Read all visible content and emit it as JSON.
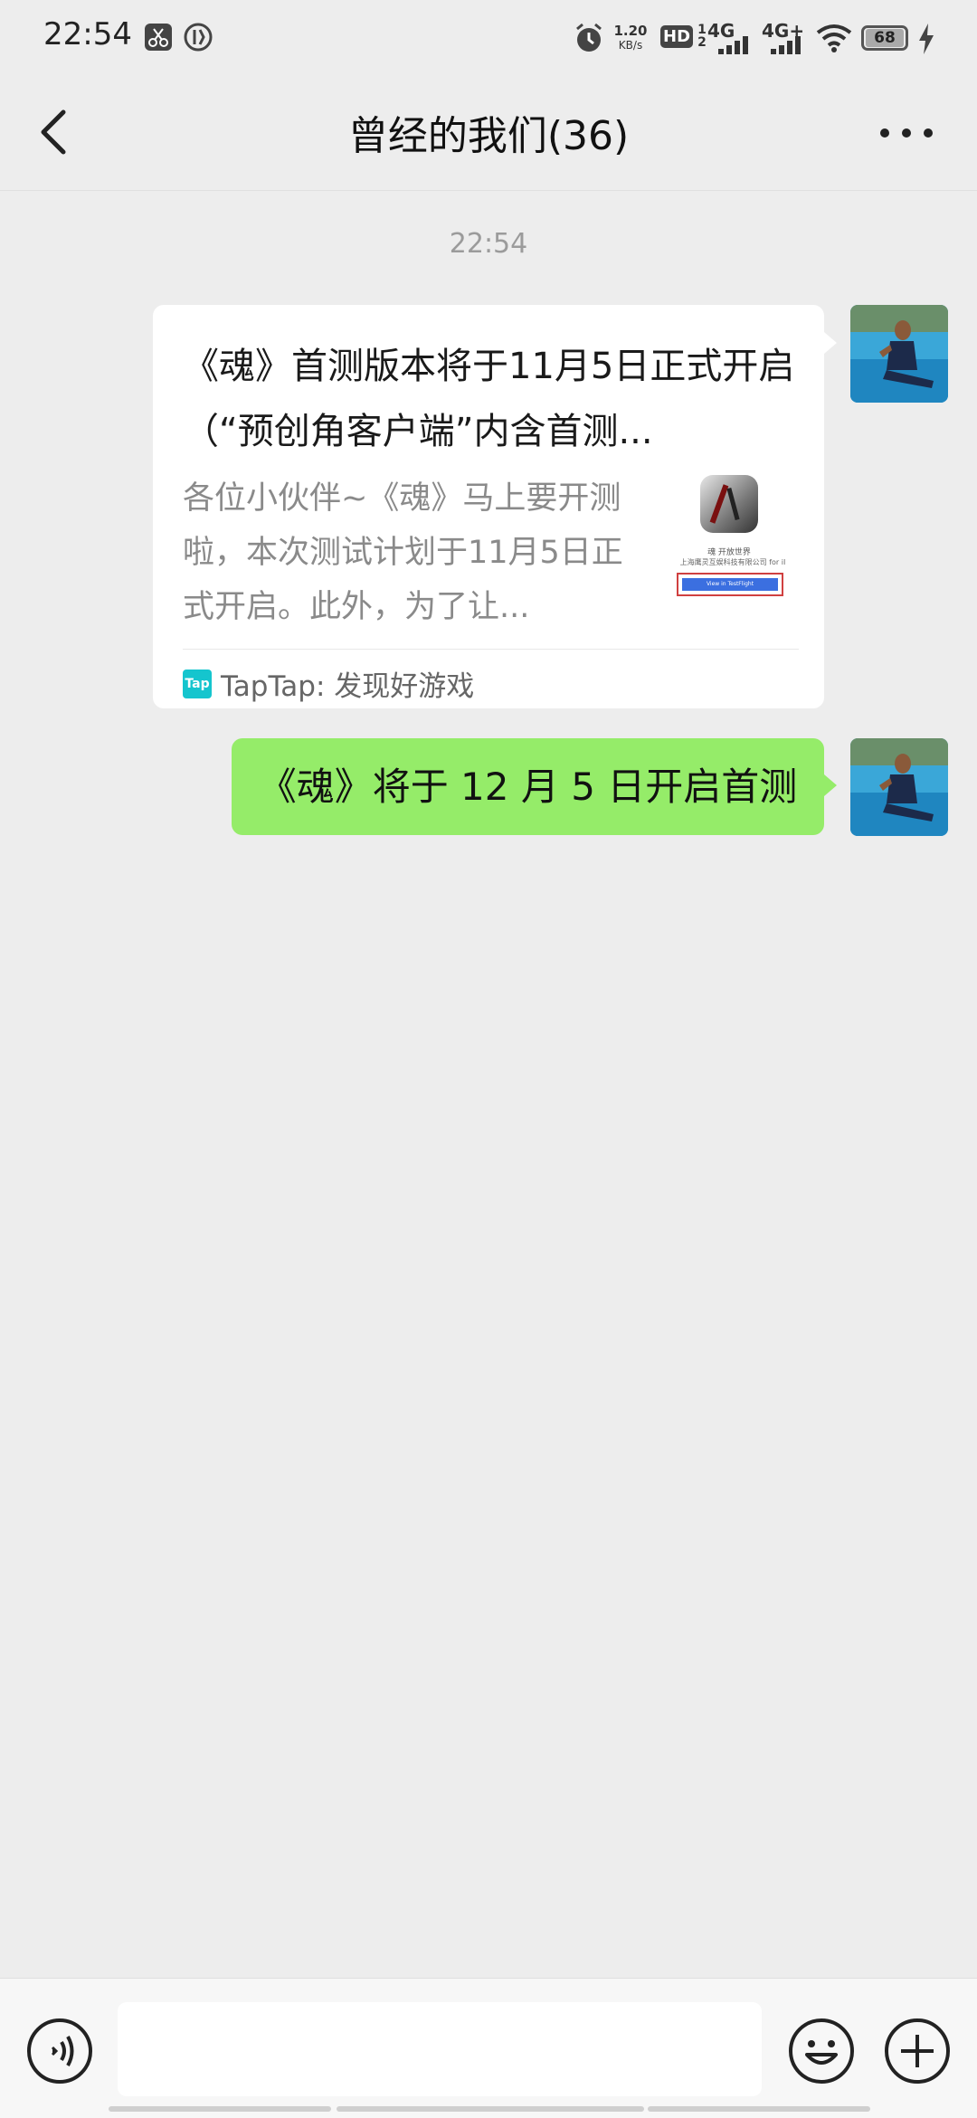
{
  "status_bar": {
    "time": "22:54",
    "net_speed_value": "1.20",
    "net_speed_unit": "KB/s",
    "hd_label": "HD",
    "hd_sub_top": "1",
    "hd_sub_bottom": "2",
    "sim1": "4G",
    "sim2": "4G+",
    "battery": "68",
    "icons": [
      "scissors-app-icon",
      "vpn-icon",
      "alarm-icon",
      "signal-icon",
      "wifi-icon",
      "battery-icon",
      "charging-icon"
    ]
  },
  "nav": {
    "title": "曾经的我们(36)",
    "back_icon": "chevron-left-icon",
    "more_icon": "more-dots-icon"
  },
  "chat": {
    "timestamp": "22:54",
    "link_card": {
      "title": "《魂》首测版本将于11月5日正式开启（“预创角客户端”内含首测...",
      "description": "各位小伙伴~《魂》马上要开测啦，本次测试计划于11月5日正式开启。此外，为了让...",
      "thumbnail_caption": "魂 开放世界",
      "thumbnail_company": "上海鹰灵互娱科技有限公司 for iI",
      "thumbnail_button": "View in TestFlight",
      "source_logo": "Tap",
      "source": "TapTap: 发现好游戏"
    },
    "text_message": "《魂》将于 12 月 5 日开启首测"
  },
  "input_bar": {
    "voice_icon": "voice-icon",
    "emoji_icon": "emoji-icon",
    "plus_icon": "plus-circle-icon",
    "input_value": ""
  },
  "colors": {
    "background": "#ededed",
    "bubble_green": "#95ec69",
    "tap_cyan": "#15c5ce"
  }
}
